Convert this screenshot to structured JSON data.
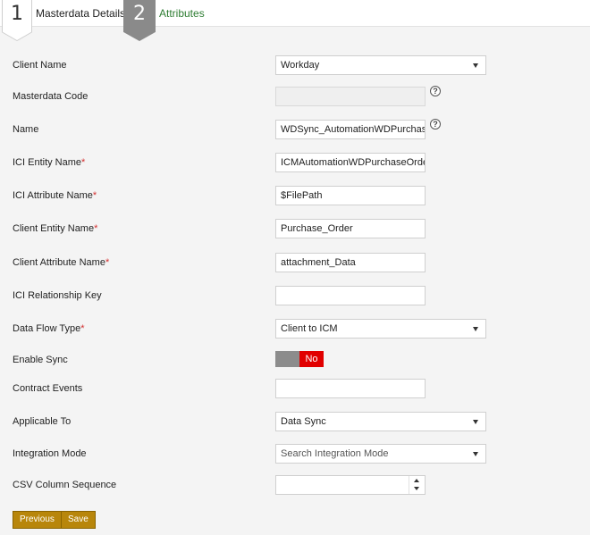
{
  "steps": [
    {
      "number": "1",
      "label": "Masterdata Details"
    },
    {
      "number": "2",
      "label": "Attributes"
    }
  ],
  "form": {
    "client_name": {
      "label": "Client Name",
      "value": "Workday"
    },
    "masterdata_code": {
      "label": "Masterdata Code",
      "value": ""
    },
    "name": {
      "label": "Name",
      "value": "WDSync_AutomationWDPurchaseOr"
    },
    "ici_entity_name": {
      "label": "ICI Entity Name",
      "required": "*",
      "value": "ICMAutomationWDPurchaseOrder"
    },
    "ici_attribute_name": {
      "label": "ICI Attribute Name",
      "required": "*",
      "value": "$FilePath"
    },
    "client_entity_name": {
      "label": "Client Entity Name",
      "required": "*",
      "value": "Purchase_Order"
    },
    "client_attribute_name": {
      "label": "Client Attribute Name",
      "required": "*",
      "value": "attachment_Data"
    },
    "ici_relationship_key": {
      "label": "ICI Relationship Key",
      "value": ""
    },
    "data_flow_type": {
      "label": "Data Flow Type",
      "required": "*",
      "value": "Client to ICM"
    },
    "enable_sync": {
      "label": "Enable Sync",
      "value": "No"
    },
    "contract_events": {
      "label": "Contract Events",
      "value": ""
    },
    "applicable_to": {
      "label": "Applicable To",
      "value": "Data Sync"
    },
    "integration_mode": {
      "label": "Integration Mode",
      "placeholder": "Search Integration Mode"
    },
    "csv_column_sequence": {
      "label": "CSV Column Sequence",
      "value": ""
    }
  },
  "help_glyph": "?",
  "buttons": {
    "previous": "Previous",
    "save": "Save"
  },
  "colors": {
    "accent_button": "#b8860b",
    "toggle_off": "#e10000",
    "required": "#d32f2f",
    "step2_badge": "#8a8a8a",
    "step2_label": "#2e7d32"
  }
}
